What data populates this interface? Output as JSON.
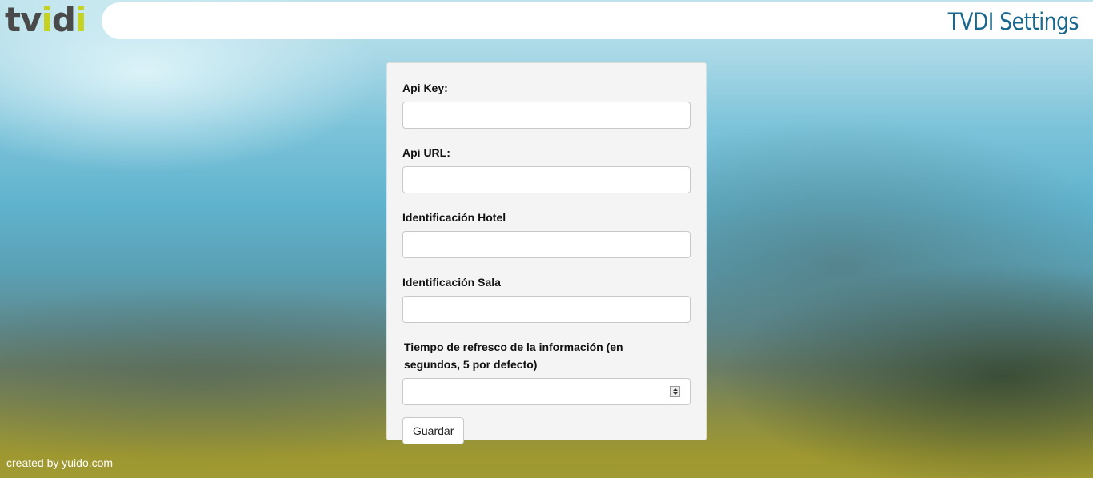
{
  "header": {
    "logo": {
      "part1": "tv",
      "part2": "i",
      "part3": "d",
      "part4": "i"
    },
    "title": "TVDI Settings"
  },
  "form": {
    "fields": [
      {
        "label": "Api Key:",
        "value": "",
        "placeholder": ""
      },
      {
        "label": "Api URL:",
        "value": "",
        "placeholder": ""
      },
      {
        "label": "Identificación Hotel",
        "value": "",
        "placeholder": ""
      },
      {
        "label": "Identificación Sala",
        "value": "",
        "placeholder": ""
      },
      {
        "label": "Tiempo de refresco de la información (en segundos, 5 por defecto)",
        "value": "",
        "placeholder": ""
      }
    ],
    "save_label": "Guardar"
  },
  "footer": {
    "text": "created by yuido.com"
  },
  "colors": {
    "title": "#17678e",
    "logo_dark": "#4a4a4a",
    "logo_accent": "#c5d21e"
  },
  "icons": {
    "spinner": "number-spinner-icon"
  }
}
